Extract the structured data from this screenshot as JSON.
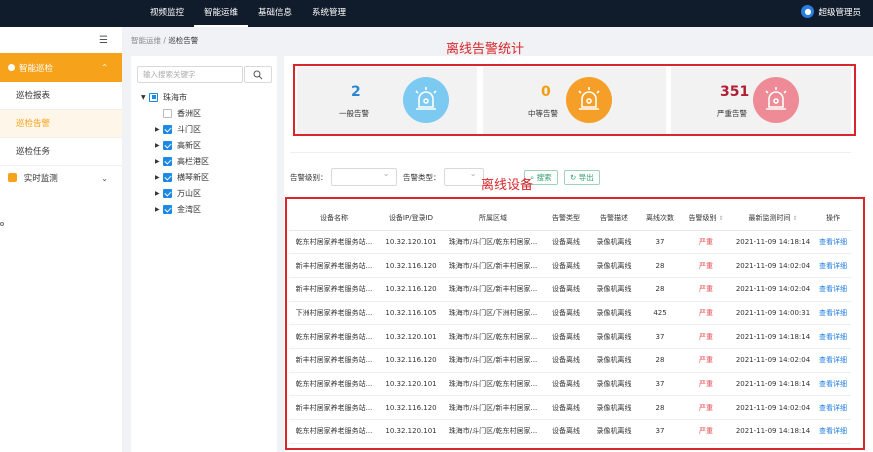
{
  "topnav": {
    "items": [
      "视频监控",
      "智能运维",
      "基础信息",
      "系统管理"
    ],
    "user": "超级管理员"
  },
  "sidebar": {
    "collapse_icon": "menu-fold-icon",
    "group1": "智能巡检",
    "items": [
      "巡检报表",
      "巡检告警",
      "巡检任务"
    ],
    "group2": "实时监测"
  },
  "breadcrumb": {
    "parent": "智能运维",
    "sep": "/",
    "current": "巡检告警"
  },
  "tree": {
    "search_placeholder": "输入搜索关键字",
    "root": "珠海市",
    "children": [
      "香洲区",
      "斗门区",
      "高新区",
      "高栏港区",
      "横琴新区",
      "万山区",
      "金湾区"
    ]
  },
  "stats": [
    {
      "value": "2",
      "label": "一般告警",
      "color": "#2a86d1",
      "circle": "#7ccaf1"
    },
    {
      "value": "0",
      "label": "中等告警",
      "color": "#f39c12",
      "circle": "#f59f28"
    },
    {
      "value": "351",
      "label": "严重告警",
      "color": "#b21f35",
      "circle": "#ee8b97"
    }
  ],
  "annotations": {
    "stats": "离线告警统计",
    "table": "离线设备"
  },
  "filters": {
    "level_label": "告警级别：",
    "type_label": "告警类型：",
    "search_btn": "搜索",
    "export_btn": "导出"
  },
  "table": {
    "headers": [
      "设备名称",
      "设备IP/登录ID",
      "所属区域",
      "告警类型",
      "告警描述",
      "离线次数",
      "告警级别",
      "最新监测时间",
      "操作"
    ],
    "rows": [
      [
        "乾东村居家养老服务站...",
        "10.32.120.101",
        "珠海市/斗门区/乾东村居家...",
        "设备离线",
        "录像机离线",
        "37",
        "严重",
        "2021-11-09 14:18:14",
        "查看详细"
      ],
      [
        "新丰村居家养老服务站...",
        "10.32.116.120",
        "珠海市/斗门区/新丰村居家...",
        "设备离线",
        "录像机离线",
        "28",
        "严重",
        "2021-11-09 14:02:04",
        "查看详细"
      ],
      [
        "新丰村居家养老服务站...",
        "10.32.116.120",
        "珠海市/斗门区/新丰村居家...",
        "设备离线",
        "录像机离线",
        "28",
        "严重",
        "2021-11-09 14:02:04",
        "查看详细"
      ],
      [
        "下洲村居家养老服务站...",
        "10.32.116.105",
        "珠海市/斗门区/下洲村居家...",
        "设备离线",
        "录像机离线",
        "425",
        "严重",
        "2021-11-09 14:00:31",
        "查看详细"
      ],
      [
        "乾东村居家养老服务站...",
        "10.32.120.101",
        "珠海市/斗门区/乾东村居家...",
        "设备离线",
        "录像机离线",
        "37",
        "严重",
        "2021-11-09 14:18:14",
        "查看详细"
      ],
      [
        "新丰村居家养老服务站...",
        "10.32.116.120",
        "珠海市/斗门区/新丰村居家...",
        "设备离线",
        "录像机离线",
        "28",
        "严重",
        "2021-11-09 14:02:04",
        "查看详细"
      ],
      [
        "乾东村居家养老服务站...",
        "10.32.120.101",
        "珠海市/斗门区/乾东村居家...",
        "设备离线",
        "录像机离线",
        "37",
        "严重",
        "2021-11-09 14:18:14",
        "查看详细"
      ],
      [
        "新丰村居家养老服务站...",
        "10.32.116.120",
        "珠海市/斗门区/新丰村居家...",
        "设备离线",
        "录像机离线",
        "28",
        "严重",
        "2021-11-09 14:02:04",
        "查看详细"
      ],
      [
        "乾东村居家养老服务站...",
        "10.32.120.101",
        "珠海市/斗门区/乾东村居家...",
        "设备离线",
        "录像机离线",
        "37",
        "严重",
        "2021-11-09 14:18:14",
        "查看详细"
      ]
    ]
  }
}
